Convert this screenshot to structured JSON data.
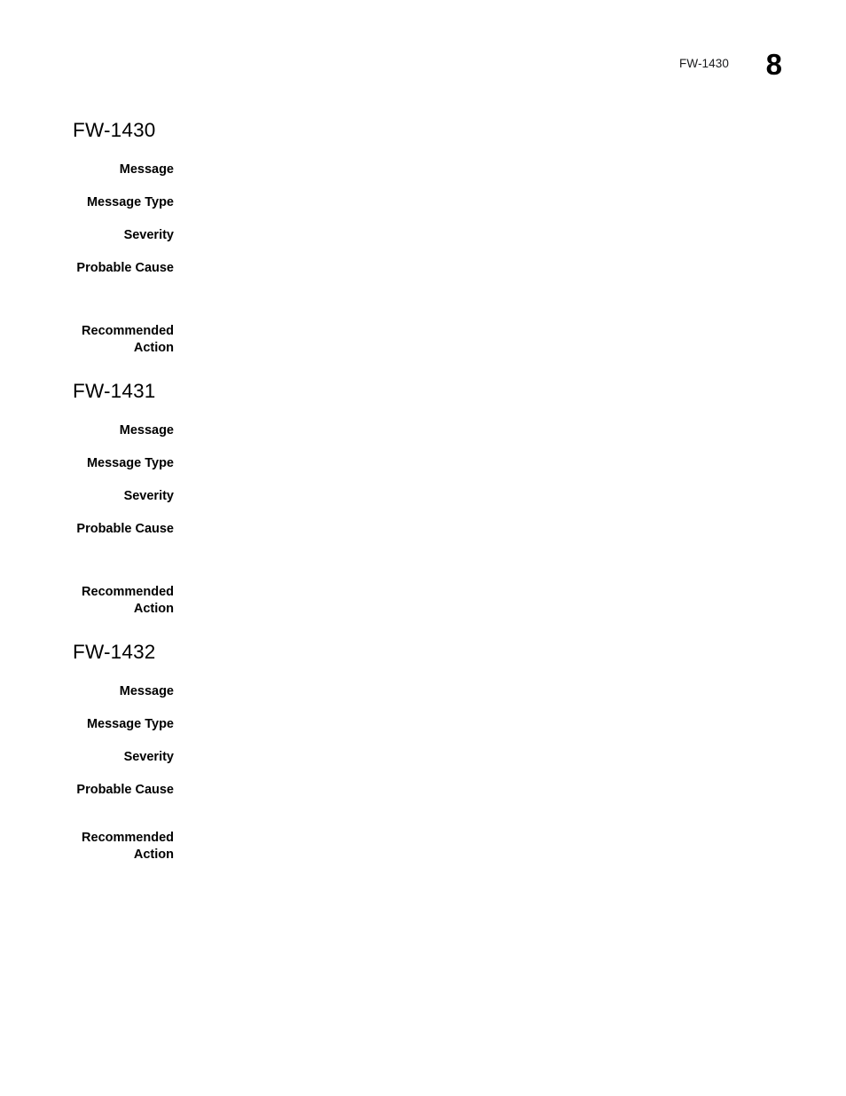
{
  "header": {
    "running_head": "FW-1430",
    "page_number": "8"
  },
  "sections": [
    {
      "heading": "FW-1430",
      "fields": [
        {
          "label": "Message",
          "value": ""
        },
        {
          "label": "Message Type",
          "value": ""
        },
        {
          "label": "Severity",
          "value": ""
        },
        {
          "label": "Probable Cause",
          "value": ""
        },
        {
          "label": "Recommended\nAction",
          "value": ""
        }
      ]
    },
    {
      "heading": "FW-1431",
      "fields": [
        {
          "label": "Message",
          "value": ""
        },
        {
          "label": "Message Type",
          "value": ""
        },
        {
          "label": "Severity",
          "value": ""
        },
        {
          "label": "Probable Cause",
          "value": ""
        },
        {
          "label": "Recommended\nAction",
          "value": ""
        }
      ]
    },
    {
      "heading": "FW-1432",
      "fields": [
        {
          "label": "Message",
          "value": ""
        },
        {
          "label": "Message Type",
          "value": ""
        },
        {
          "label": "Severity",
          "value": ""
        },
        {
          "label": "Probable Cause",
          "value": ""
        },
        {
          "label": "Recommended\nAction",
          "value": ""
        }
      ]
    }
  ],
  "layout": {
    "section_tops": [
      134,
      428,
      722
    ],
    "field_tops": [
      [
        48,
        85,
        122,
        159,
        230
      ],
      [
        48,
        85,
        122,
        159,
        230
      ],
      [
        48,
        85,
        122,
        159,
        213
      ]
    ]
  }
}
